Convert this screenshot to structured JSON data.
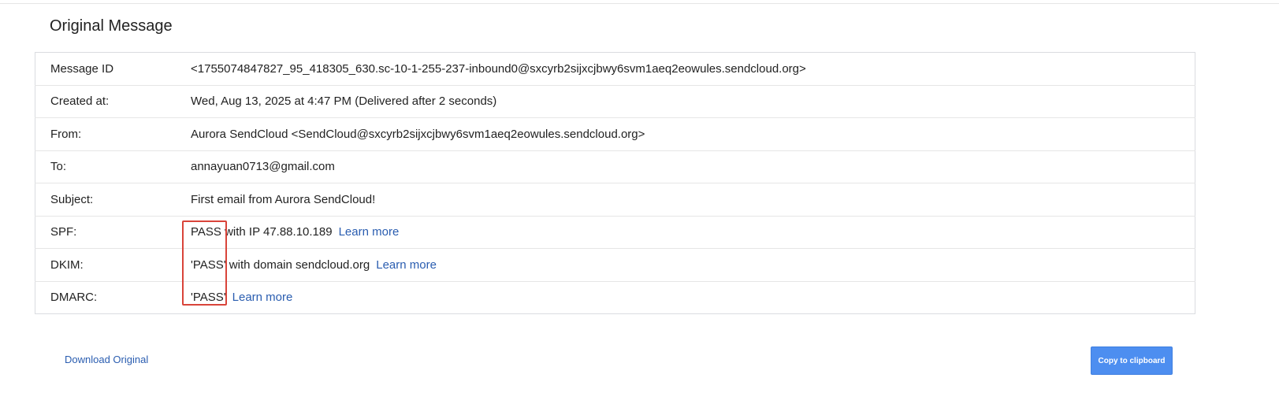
{
  "page": {
    "title": "Original Message"
  },
  "headers": {
    "message_id": {
      "label": "Message ID",
      "value": "<1755074847827_95_418305_630.sc-10-1-255-237-inbound0@sxcyrb2sijxcjbwy6svm1aeq2eowules.sendcloud.org>"
    },
    "created_at": {
      "label": "Created at:",
      "value": "Wed, Aug 13, 2025 at 4:47 PM (Delivered after 2 seconds)"
    },
    "from": {
      "label": "From:",
      "value": "Aurora SendCloud <SendCloud@sxcyrb2sijxcjbwy6svm1aeq2eowules.sendcloud.org>"
    },
    "to": {
      "label": "To:",
      "value": "annayuan0713@gmail.com"
    },
    "subject": {
      "label": "Subject:",
      "value": "First email from Aurora SendCloud!"
    },
    "spf": {
      "label": "SPF:",
      "value": "PASS with IP 47.88.10.189",
      "learn_more": "Learn more"
    },
    "dkim": {
      "label": "DKIM:",
      "value": "'PASS' with domain sendcloud.org",
      "learn_more": "Learn more"
    },
    "dmarc": {
      "label": "DMARC:",
      "value": "'PASS'",
      "learn_more": "Learn more"
    }
  },
  "footer": {
    "download_label": "Download Original",
    "copy_label": "Copy to clipboard"
  },
  "colors": {
    "message_id": "#3c8c3c",
    "link": "#2a5db0",
    "button": "#4d8ef0",
    "highlight": "#d9443a"
  }
}
